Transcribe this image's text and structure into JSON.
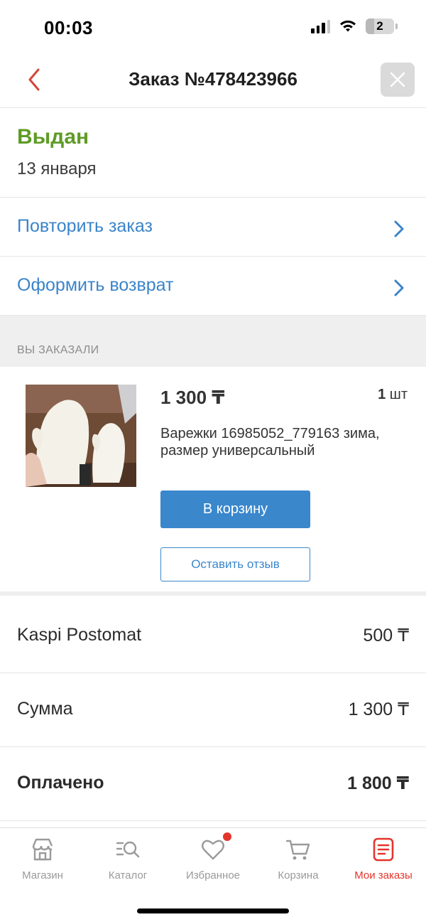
{
  "status_bar": {
    "time": "00:03",
    "battery_level": "2"
  },
  "header": {
    "title": "Заказ №478423966"
  },
  "order": {
    "status": "Выдан",
    "date": "13 января",
    "status_color": "#5f9b26"
  },
  "actions": [
    {
      "label": "Повторить заказ"
    },
    {
      "label": "Оформить возврат"
    }
  ],
  "section": {
    "ordered_label": "ВЫ ЗАКАЗАЛИ"
  },
  "product": {
    "price": "1 300 ₸",
    "qty_number": "1",
    "qty_unit": "шт",
    "name": "Варежки 16985052_779163 зима, размер универсальный",
    "cart_button": "В корзину",
    "review_button": "Оставить отзыв"
  },
  "summary": [
    {
      "label": "Kaspi Postomat",
      "value": "500 ₸"
    },
    {
      "label": "Сумма",
      "value": "1 300 ₸"
    },
    {
      "label": "Оплачено",
      "value": "1 800 ₸"
    }
  ],
  "nav": {
    "items": [
      {
        "label": "Магазин",
        "icon": "store-icon"
      },
      {
        "label": "Каталог",
        "icon": "catalog-search-icon"
      },
      {
        "label": "Избранное",
        "icon": "heart-icon"
      },
      {
        "label": "Корзина",
        "icon": "cart-icon"
      },
      {
        "label": "Мои заказы",
        "icon": "orders-icon"
      }
    ],
    "active_color": "#e4352b",
    "accent_color": "#3a87cc"
  }
}
